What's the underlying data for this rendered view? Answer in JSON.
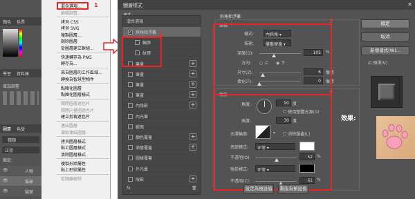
{
  "ps_left": {
    "tab_color": "顏色",
    "tab_swatch": "色票",
    "tab_learn": "學習",
    "tab_lib": "資料庫",
    "adjust": "增加調整",
    "tab_layers": "圖層",
    "tab_channels": "色版",
    "kind": "種類",
    "blend": "正常",
    "lock": "鎖定:",
    "layer1": "人物",
    "layer2": "貓掌",
    "layer3": "貓掌"
  },
  "menu": {
    "number": "1",
    "items": [
      {
        "label": "混合選項...",
        "disabled": false
      },
      {
        "label": "編輯調整...",
        "disabled": true
      },
      {
        "label": "拷貝 CSS",
        "disabled": false
      },
      {
        "label": "拷貝 SVG",
        "disabled": false
      },
      {
        "label": "複製圖層...",
        "disabled": false
      },
      {
        "label": "刪除圖層",
        "disabled": false
      },
      {
        "label": "從圖層建立群組...",
        "disabled": false
      },
      {
        "label": "快速轉存為 PNG",
        "disabled": false
      },
      {
        "label": "轉存為...",
        "disabled": false
      },
      {
        "label": "來自圖層的工作區域...",
        "disabled": false
      },
      {
        "label": "轉換為智慧型物件",
        "disabled": false
      },
      {
        "label": "點陣化圖層",
        "disabled": false
      },
      {
        "label": "點陣化圖層樣式",
        "disabled": false
      },
      {
        "label": "關閉圖層遮色片",
        "disabled": true
      },
      {
        "label": "關閉向量圖遮色片",
        "disabled": true
      },
      {
        "label": "建立剪裁遮色片",
        "disabled": false
      },
      {
        "label": "連結圖層",
        "disabled": true
      },
      {
        "label": "選取連結圖層",
        "disabled": true
      },
      {
        "label": "拷貝圖層樣式",
        "disabled": false
      },
      {
        "label": "貼上圖層樣式",
        "disabled": false
      },
      {
        "label": "清除圖層樣式",
        "disabled": false
      },
      {
        "label": "複製形狀屬性",
        "disabled": false
      },
      {
        "label": "貼上形狀屬性",
        "disabled": false
      },
      {
        "label": "從隔離解除",
        "disabled": true
      }
    ]
  },
  "dialog": {
    "title": "圖層樣式",
    "close": "✕",
    "num2": "2",
    "num3": "3",
    "num4": "4",
    "styles_header": "樣式",
    "blend_header": "混合選項",
    "styles": [
      {
        "label": "斜角和浮雕",
        "checked": true,
        "plus": false,
        "sub": false,
        "selected": true
      },
      {
        "label": "輪廓",
        "checked": false,
        "plus": false,
        "sub": true,
        "selected": false
      },
      {
        "label": "紋理",
        "checked": false,
        "plus": false,
        "sub": true,
        "selected": false
      },
      {
        "label": "筆畫",
        "checked": false,
        "plus": true,
        "sub": false,
        "selected": false
      },
      {
        "label": "筆畫",
        "checked": false,
        "plus": true,
        "sub": false,
        "selected": false
      },
      {
        "label": "筆畫",
        "checked": false,
        "plus": true,
        "sub": false,
        "selected": false
      },
      {
        "label": "筆畫",
        "checked": false,
        "plus": true,
        "sub": false,
        "selected": false
      },
      {
        "label": "內陰影",
        "checked": false,
        "plus": true,
        "sub": false,
        "selected": false
      },
      {
        "label": "內光暈",
        "checked": false,
        "plus": false,
        "sub": false,
        "selected": false
      },
      {
        "label": "緞面",
        "checked": false,
        "plus": false,
        "sub": false,
        "selected": false
      },
      {
        "label": "顏色覆蓋",
        "checked": false,
        "plus": true,
        "sub": false,
        "selected": false
      },
      {
        "label": "漸層覆蓋",
        "checked": false,
        "plus": true,
        "sub": false,
        "selected": false
      },
      {
        "label": "圖樣覆蓋",
        "checked": false,
        "plus": false,
        "sub": false,
        "selected": false
      },
      {
        "label": "外光暈",
        "checked": false,
        "plus": false,
        "sub": false,
        "selected": false
      },
      {
        "label": "陰影",
        "checked": false,
        "plus": true,
        "sub": false,
        "selected": false
      }
    ],
    "fx": "fx.",
    "section_title": "斜角和浮雕",
    "structure": {
      "title": "結構",
      "style_label": "樣式:",
      "style_value": "內斜角",
      "tech_label": "技術:",
      "tech_value": "雕鑿硬邊",
      "depth_label": "深度(D):",
      "depth_value": "105",
      "depth_unit": "%",
      "depth_pct": 0.35,
      "dir_label": "方向:",
      "dir_up": "上",
      "dir_down": "下",
      "size_label": "尺寸(Z):",
      "size_value": "6",
      "size_unit": "像素",
      "size_pct": 0.08,
      "soften_label": "柔化(F):",
      "soften_value": "0",
      "soften_unit": "像素",
      "soften_pct": 0.0
    },
    "shading": {
      "title": "陰影",
      "angle_label": "角度:",
      "angle_value": "90",
      "angle_unit": "度",
      "global_light": "使用整體光源(G)",
      "altitude_label": "高度:",
      "altitude_value": "30",
      "altitude_unit": "度",
      "gloss_label": "光澤輪廓:",
      "antialias": "消除鋸齒(L)",
      "hl_mode_label": "亮部模式:",
      "hl_mode_value": "正常",
      "hl_opacity_label": "不透明(O):",
      "hl_opacity_value": "52",
      "hl_opacity_pct": 0.52,
      "sh_mode_label": "陰影模式:",
      "sh_mode_value": "正常",
      "sh_opacity_label": "不透明(C):",
      "sh_opacity_value": "61",
      "sh_opacity_pct": 0.61,
      "pct": "%"
    },
    "set_default": "設定為預設值",
    "reset_default": "重設為預設值",
    "ok": "確定",
    "cancel": "取消",
    "new_style": "新增樣式(W)...",
    "preview": "預視(V)",
    "effect_label": "效果:"
  },
  "colors": {
    "panel_bg": "#535353",
    "red": "#e22222",
    "highlight_color": "#ffffff",
    "shadow_color": "#000000"
  }
}
